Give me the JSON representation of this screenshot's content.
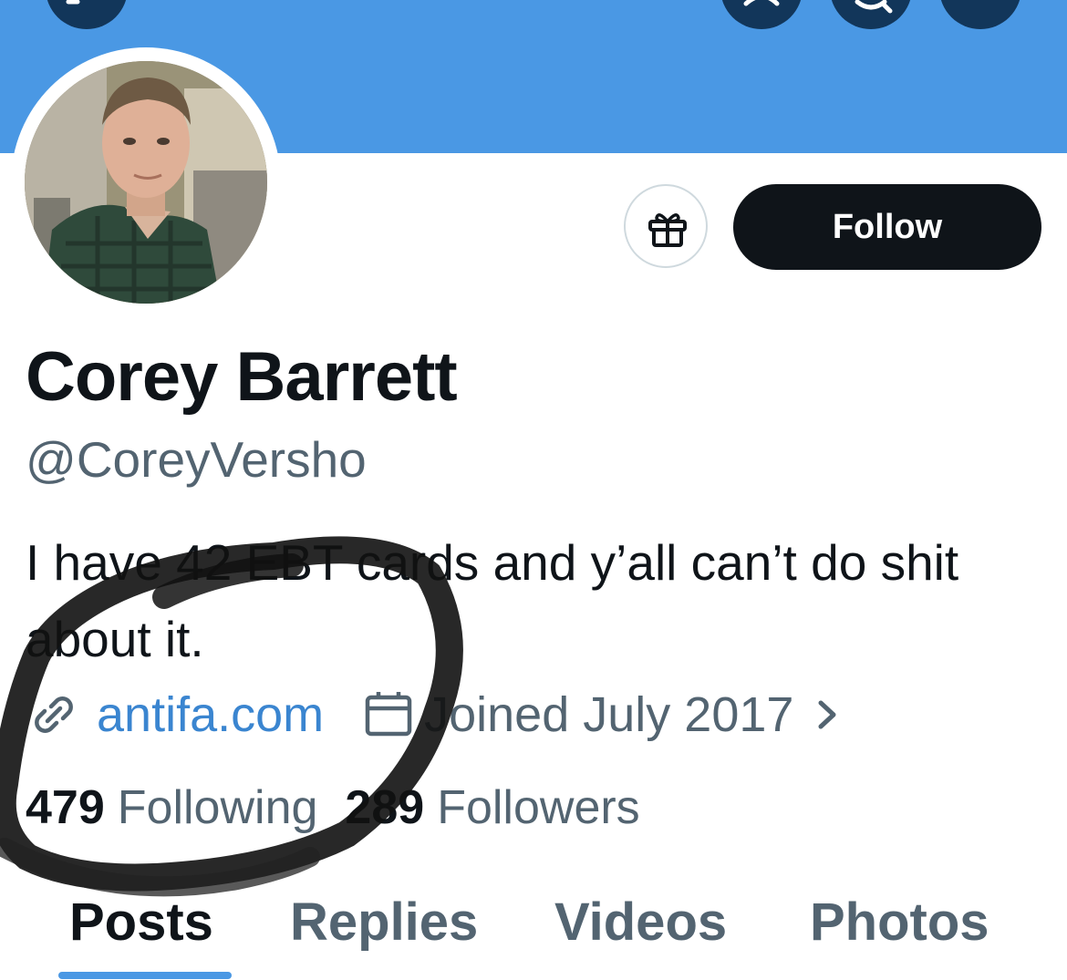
{
  "header": {
    "banner_color": "#4a98e4",
    "buttons": [
      "back-arrow-icon",
      "search-icon",
      "more-icon"
    ]
  },
  "profile": {
    "display_name": "Corey Barrett",
    "handle": "@CoreyVersho",
    "bio": "I have 42 EBT cards and y’all can’t do shit about it.",
    "website": "antifa.com",
    "joined": "Joined July 2017",
    "following_count": "479",
    "following_label": "Following",
    "followers_count": "289",
    "followers_label": "Followers"
  },
  "actions": {
    "gift_icon": "gift-icon",
    "follow_label": "Follow"
  },
  "tabs": [
    {
      "label": "Posts",
      "active": true
    },
    {
      "label": "Replies",
      "active": false
    },
    {
      "label": "Videos",
      "active": false
    },
    {
      "label": "Photos",
      "active": false
    }
  ],
  "colors": {
    "accent": "#4a98e4",
    "link": "#3a85d0",
    "text_primary": "#0f1419",
    "text_secondary": "#536471"
  }
}
